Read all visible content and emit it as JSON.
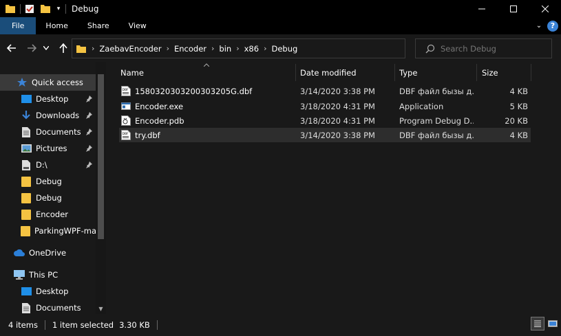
{
  "window": {
    "title": "Debug"
  },
  "ribbon": {
    "tabs": [
      "File",
      "Home",
      "Share",
      "View"
    ]
  },
  "address": {
    "crumbs": [
      "ZaebavEncoder",
      "Encoder",
      "bin",
      "x86",
      "Debug"
    ]
  },
  "search": {
    "placeholder": "Search Debug"
  },
  "sidebar": {
    "items": [
      {
        "label": "Quick access",
        "icon": "star-icon",
        "pinned": false
      },
      {
        "label": "Desktop",
        "icon": "desktop-folder-icon",
        "pinned": true
      },
      {
        "label": "Downloads",
        "icon": "download-icon",
        "pinned": true
      },
      {
        "label": "Documents",
        "icon": "documents-icon",
        "pinned": true
      },
      {
        "label": "Pictures",
        "icon": "pictures-icon",
        "pinned": true
      },
      {
        "label": "D:\\",
        "icon": "drive-icon",
        "pinned": true
      },
      {
        "label": "Debug",
        "icon": "folder-icon",
        "pinned": false
      },
      {
        "label": "Debug",
        "icon": "folder-icon",
        "pinned": false
      },
      {
        "label": "Encoder",
        "icon": "folder-icon",
        "pinned": false
      },
      {
        "label": "ParkingWPF-ma",
        "icon": "folder-icon",
        "pinned": false
      },
      {
        "label": "OneDrive",
        "icon": "cloud-icon",
        "pinned": false
      },
      {
        "label": "This PC",
        "icon": "computer-icon",
        "pinned": false
      },
      {
        "label": "Desktop",
        "icon": "desktop-folder-icon",
        "pinned": false
      },
      {
        "label": "Documents",
        "icon": "documents-icon",
        "pinned": false
      }
    ]
  },
  "columns": {
    "name": "Name",
    "date": "Date modified",
    "type": "Type",
    "size": "Size"
  },
  "files": [
    {
      "name": "1580320303200303205G.dbf",
      "date": "3/14/2020 3:38 PM",
      "type": "DBF файл бызы д...",
      "size": "4 KB",
      "icon": "dbf-file-icon"
    },
    {
      "name": "Encoder.exe",
      "date": "3/18/2020 4:31 PM",
      "type": "Application",
      "size": "5 KB",
      "icon": "exe-file-icon"
    },
    {
      "name": "Encoder.pdb",
      "date": "3/18/2020 4:31 PM",
      "type": "Program Debug D...",
      "size": "20 KB",
      "icon": "pdb-file-icon"
    },
    {
      "name": "try.dbf",
      "date": "3/14/2020 3:38 PM",
      "type": "DBF файл бызы д...",
      "size": "4 KB",
      "icon": "dbf-file-icon"
    }
  ],
  "status": {
    "items": "4 items",
    "selected": "1 item selected",
    "size": "3.30 KB"
  },
  "colors": {
    "folder": "#f5c342",
    "accent": "#1a4d7a",
    "selectedRow": "#2d2d2d",
    "help": "#3b83d6"
  }
}
